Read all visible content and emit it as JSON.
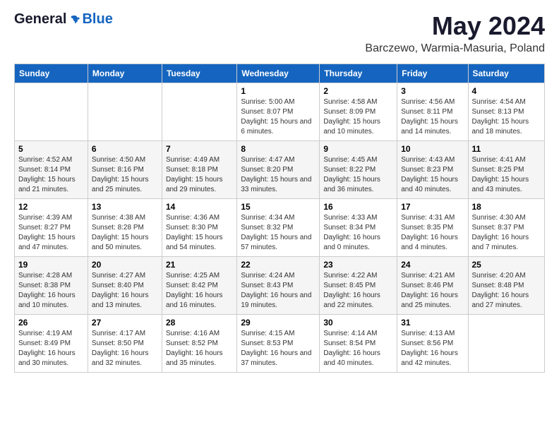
{
  "header": {
    "logo_general": "General",
    "logo_blue": "Blue",
    "title": "May 2024",
    "location": "Barczewo, Warmia-Masuria, Poland"
  },
  "weekdays": [
    "Sunday",
    "Monday",
    "Tuesday",
    "Wednesday",
    "Thursday",
    "Friday",
    "Saturday"
  ],
  "weeks": [
    [
      {
        "day": "",
        "sunrise": "",
        "sunset": "",
        "daylight": ""
      },
      {
        "day": "",
        "sunrise": "",
        "sunset": "",
        "daylight": ""
      },
      {
        "day": "",
        "sunrise": "",
        "sunset": "",
        "daylight": ""
      },
      {
        "day": "1",
        "sunrise": "Sunrise: 5:00 AM",
        "sunset": "Sunset: 8:07 PM",
        "daylight": "Daylight: 15 hours and 6 minutes."
      },
      {
        "day": "2",
        "sunrise": "Sunrise: 4:58 AM",
        "sunset": "Sunset: 8:09 PM",
        "daylight": "Daylight: 15 hours and 10 minutes."
      },
      {
        "day": "3",
        "sunrise": "Sunrise: 4:56 AM",
        "sunset": "Sunset: 8:11 PM",
        "daylight": "Daylight: 15 hours and 14 minutes."
      },
      {
        "day": "4",
        "sunrise": "Sunrise: 4:54 AM",
        "sunset": "Sunset: 8:13 PM",
        "daylight": "Daylight: 15 hours and 18 minutes."
      }
    ],
    [
      {
        "day": "5",
        "sunrise": "Sunrise: 4:52 AM",
        "sunset": "Sunset: 8:14 PM",
        "daylight": "Daylight: 15 hours and 21 minutes."
      },
      {
        "day": "6",
        "sunrise": "Sunrise: 4:50 AM",
        "sunset": "Sunset: 8:16 PM",
        "daylight": "Daylight: 15 hours and 25 minutes."
      },
      {
        "day": "7",
        "sunrise": "Sunrise: 4:49 AM",
        "sunset": "Sunset: 8:18 PM",
        "daylight": "Daylight: 15 hours and 29 minutes."
      },
      {
        "day": "8",
        "sunrise": "Sunrise: 4:47 AM",
        "sunset": "Sunset: 8:20 PM",
        "daylight": "Daylight: 15 hours and 33 minutes."
      },
      {
        "day": "9",
        "sunrise": "Sunrise: 4:45 AM",
        "sunset": "Sunset: 8:22 PM",
        "daylight": "Daylight: 15 hours and 36 minutes."
      },
      {
        "day": "10",
        "sunrise": "Sunrise: 4:43 AM",
        "sunset": "Sunset: 8:23 PM",
        "daylight": "Daylight: 15 hours and 40 minutes."
      },
      {
        "day": "11",
        "sunrise": "Sunrise: 4:41 AM",
        "sunset": "Sunset: 8:25 PM",
        "daylight": "Daylight: 15 hours and 43 minutes."
      }
    ],
    [
      {
        "day": "12",
        "sunrise": "Sunrise: 4:39 AM",
        "sunset": "Sunset: 8:27 PM",
        "daylight": "Daylight: 15 hours and 47 minutes."
      },
      {
        "day": "13",
        "sunrise": "Sunrise: 4:38 AM",
        "sunset": "Sunset: 8:28 PM",
        "daylight": "Daylight: 15 hours and 50 minutes."
      },
      {
        "day": "14",
        "sunrise": "Sunrise: 4:36 AM",
        "sunset": "Sunset: 8:30 PM",
        "daylight": "Daylight: 15 hours and 54 minutes."
      },
      {
        "day": "15",
        "sunrise": "Sunrise: 4:34 AM",
        "sunset": "Sunset: 8:32 PM",
        "daylight": "Daylight: 15 hours and 57 minutes."
      },
      {
        "day": "16",
        "sunrise": "Sunrise: 4:33 AM",
        "sunset": "Sunset: 8:34 PM",
        "daylight": "Daylight: 16 hours and 0 minutes."
      },
      {
        "day": "17",
        "sunrise": "Sunrise: 4:31 AM",
        "sunset": "Sunset: 8:35 PM",
        "daylight": "Daylight: 16 hours and 4 minutes."
      },
      {
        "day": "18",
        "sunrise": "Sunrise: 4:30 AM",
        "sunset": "Sunset: 8:37 PM",
        "daylight": "Daylight: 16 hours and 7 minutes."
      }
    ],
    [
      {
        "day": "19",
        "sunrise": "Sunrise: 4:28 AM",
        "sunset": "Sunset: 8:38 PM",
        "daylight": "Daylight: 16 hours and 10 minutes."
      },
      {
        "day": "20",
        "sunrise": "Sunrise: 4:27 AM",
        "sunset": "Sunset: 8:40 PM",
        "daylight": "Daylight: 16 hours and 13 minutes."
      },
      {
        "day": "21",
        "sunrise": "Sunrise: 4:25 AM",
        "sunset": "Sunset: 8:42 PM",
        "daylight": "Daylight: 16 hours and 16 minutes."
      },
      {
        "day": "22",
        "sunrise": "Sunrise: 4:24 AM",
        "sunset": "Sunset: 8:43 PM",
        "daylight": "Daylight: 16 hours and 19 minutes."
      },
      {
        "day": "23",
        "sunrise": "Sunrise: 4:22 AM",
        "sunset": "Sunset: 8:45 PM",
        "daylight": "Daylight: 16 hours and 22 minutes."
      },
      {
        "day": "24",
        "sunrise": "Sunrise: 4:21 AM",
        "sunset": "Sunset: 8:46 PM",
        "daylight": "Daylight: 16 hours and 25 minutes."
      },
      {
        "day": "25",
        "sunrise": "Sunrise: 4:20 AM",
        "sunset": "Sunset: 8:48 PM",
        "daylight": "Daylight: 16 hours and 27 minutes."
      }
    ],
    [
      {
        "day": "26",
        "sunrise": "Sunrise: 4:19 AM",
        "sunset": "Sunset: 8:49 PM",
        "daylight": "Daylight: 16 hours and 30 minutes."
      },
      {
        "day": "27",
        "sunrise": "Sunrise: 4:17 AM",
        "sunset": "Sunset: 8:50 PM",
        "daylight": "Daylight: 16 hours and 32 minutes."
      },
      {
        "day": "28",
        "sunrise": "Sunrise: 4:16 AM",
        "sunset": "Sunset: 8:52 PM",
        "daylight": "Daylight: 16 hours and 35 minutes."
      },
      {
        "day": "29",
        "sunrise": "Sunrise: 4:15 AM",
        "sunset": "Sunset: 8:53 PM",
        "daylight": "Daylight: 16 hours and 37 minutes."
      },
      {
        "day": "30",
        "sunrise": "Sunrise: 4:14 AM",
        "sunset": "Sunset: 8:54 PM",
        "daylight": "Daylight: 16 hours and 40 minutes."
      },
      {
        "day": "31",
        "sunrise": "Sunrise: 4:13 AM",
        "sunset": "Sunset: 8:56 PM",
        "daylight": "Daylight: 16 hours and 42 minutes."
      },
      {
        "day": "",
        "sunrise": "",
        "sunset": "",
        "daylight": ""
      }
    ]
  ]
}
